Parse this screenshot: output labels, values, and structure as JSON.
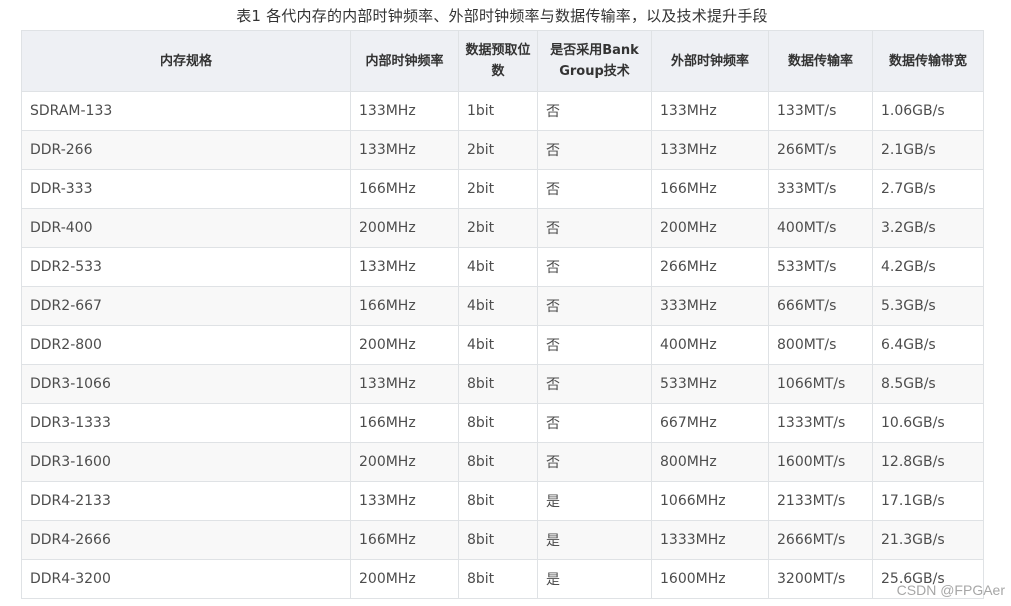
{
  "caption": "表1 各代内存的内部时钟频率、外部时钟频率与数据传输率，以及技术提升手段",
  "headers": [
    "内存规格",
    "内部时钟频率",
    "数据预取位数",
    "是否采用Bank Group技术",
    "外部时钟频率",
    "数据传输率",
    "数据传输带宽"
  ],
  "rows": [
    [
      "SDRAM-133",
      "133MHz",
      "1bit",
      "否",
      "133MHz",
      "133MT/s",
      "1.06GB/s"
    ],
    [
      "DDR-266",
      "133MHz",
      "2bit",
      "否",
      "133MHz",
      "266MT/s",
      "2.1GB/s"
    ],
    [
      "DDR-333",
      "166MHz",
      "2bit",
      "否",
      "166MHz",
      "333MT/s",
      "2.7GB/s"
    ],
    [
      "DDR-400",
      "200MHz",
      "2bit",
      "否",
      "200MHz",
      "400MT/s",
      "3.2GB/s"
    ],
    [
      "DDR2-533",
      "133MHz",
      "4bit",
      "否",
      "266MHz",
      "533MT/s",
      "4.2GB/s"
    ],
    [
      "DDR2-667",
      "166MHz",
      "4bit",
      "否",
      "333MHz",
      "666MT/s",
      "5.3GB/s"
    ],
    [
      "DDR2-800",
      "200MHz",
      "4bit",
      "否",
      "400MHz",
      "800MT/s",
      "6.4GB/s"
    ],
    [
      "DDR3-1066",
      "133MHz",
      "8bit",
      "否",
      "533MHz",
      "1066MT/s",
      "8.5GB/s"
    ],
    [
      "DDR3-1333",
      "166MHz",
      "8bit",
      "否",
      "667MHz",
      "1333MT/s",
      "10.6GB/s"
    ],
    [
      "DDR3-1600",
      "200MHz",
      "8bit",
      "否",
      "800MHz",
      "1600MT/s",
      "12.8GB/s"
    ],
    [
      "DDR4-2133",
      "133MHz",
      "8bit",
      "是",
      "1066MHz",
      "2133MT/s",
      "17.1GB/s"
    ],
    [
      "DDR4-2666",
      "166MHz",
      "8bit",
      "是",
      "1333MHz",
      "2666MT/s",
      "21.3GB/s"
    ],
    [
      "DDR4-3200",
      "200MHz",
      "8bit",
      "是",
      "1600MHz",
      "3200MT/s",
      "25.6GB/s"
    ]
  ],
  "watermark": "CSDN @FPGAer",
  "colors": {
    "header_bg": "#eef0f4",
    "border": "#dfe2e5",
    "stripe_bg": "#f8f8f8",
    "text": "#4d4d4d"
  }
}
